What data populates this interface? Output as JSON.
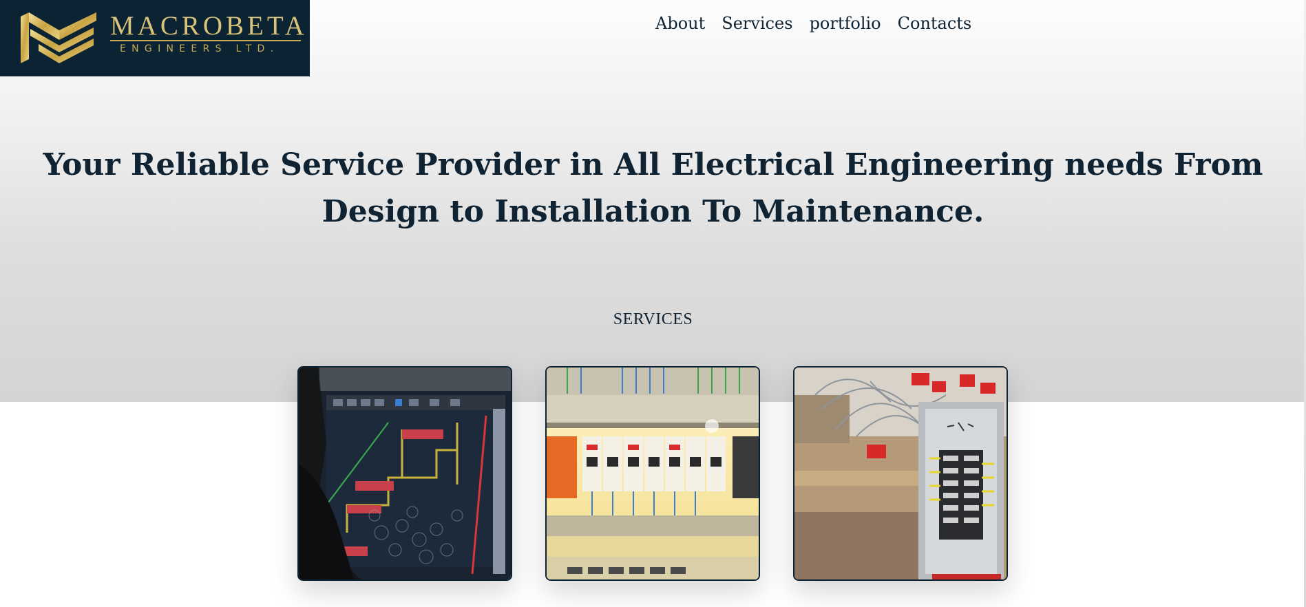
{
  "header": {
    "logo": {
      "name": "MACROBETA",
      "sub": "ENGINEERS LTD."
    },
    "nav": [
      {
        "label": "About"
      },
      {
        "label": "Services"
      },
      {
        "label": "portfolio"
      },
      {
        "label": "Contacts"
      }
    ]
  },
  "hero": {
    "headline": "Your Reliable Service Provider in All Electrical Engineering needs From Design to Installation To Maintenance."
  },
  "services": {
    "label": "SERVICES",
    "cards": [
      {
        "image": "cad-electrical-drawing-on-monitor"
      },
      {
        "image": "circuit-breaker-distribution-board"
      },
      {
        "image": "electrical-panel-with-wiring"
      }
    ]
  },
  "colors": {
    "navy": "#0c2333",
    "gold": "#d9c27a",
    "text": "#0f2333"
  }
}
